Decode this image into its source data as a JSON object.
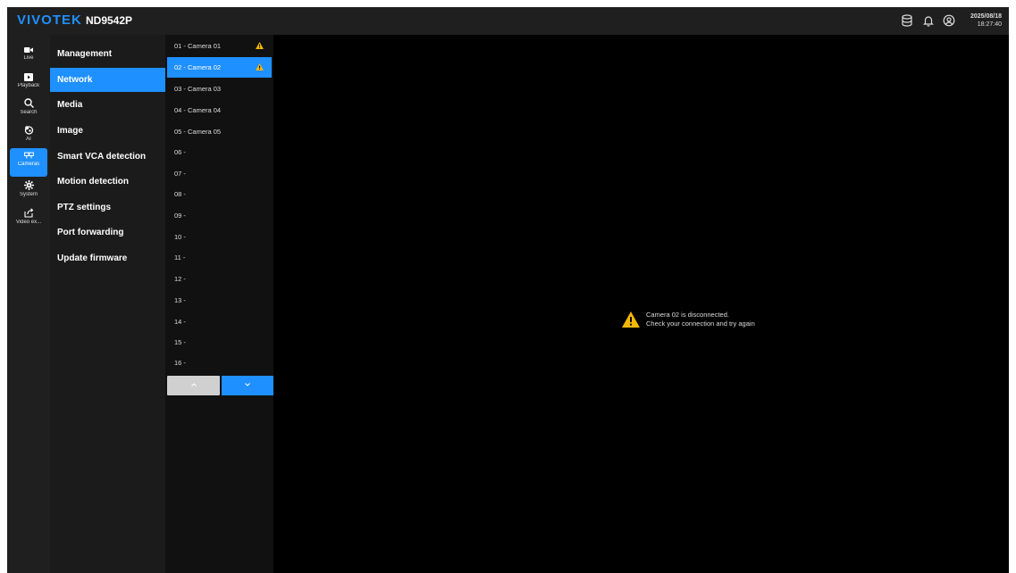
{
  "header": {
    "brand": "VIVOTEK",
    "model": "ND9542P",
    "date": "2025/08/18",
    "time": "18:27:40",
    "icons": [
      "storage-icon",
      "bell-icon",
      "user-icon"
    ]
  },
  "rail": {
    "items": [
      {
        "label": "Live",
        "icon": "video-camera-icon"
      },
      {
        "label": "Playback",
        "icon": "playback-icon"
      },
      {
        "label": "Search",
        "icon": "search-icon"
      },
      {
        "label": "AI",
        "icon": "ai-icon"
      },
      {
        "label": "Cameras",
        "icon": "cameras-icon",
        "active": true
      },
      {
        "label": "System",
        "icon": "gear-icon"
      },
      {
        "label": "Video ex...",
        "icon": "export-icon"
      }
    ]
  },
  "menu": {
    "items": [
      "Management",
      "Network",
      "Media",
      "Image",
      "Smart VCA detection",
      "Motion detection",
      "PTZ settings",
      "Port forwarding",
      "Update firmware"
    ],
    "active": "Network"
  },
  "cameras": {
    "items": [
      {
        "label": "01 - Camera 01",
        "warning": true
      },
      {
        "label": "02 - Camera 02",
        "warning": true,
        "active": true
      },
      {
        "label": "03 - Camera 03"
      },
      {
        "label": "04 - Camera 04"
      },
      {
        "label": "05 - Camera 05"
      },
      {
        "label": "06 -"
      },
      {
        "label": "07 -"
      },
      {
        "label": "08 -"
      },
      {
        "label": "09 -"
      },
      {
        "label": "10 -"
      },
      {
        "label": "11 -"
      },
      {
        "label": "12 -"
      },
      {
        "label": "13 -"
      },
      {
        "label": "14 -"
      },
      {
        "label": "15 -"
      },
      {
        "label": "16 -"
      }
    ]
  },
  "main": {
    "message_line1": "Camera 02 is disconnected.",
    "message_line2": "Check your connection and try again"
  },
  "colors": {
    "accent": "#1e90ff",
    "warning": "#f5b800",
    "topbar": "#1f1f1f",
    "menu": "#1b1b1b"
  }
}
